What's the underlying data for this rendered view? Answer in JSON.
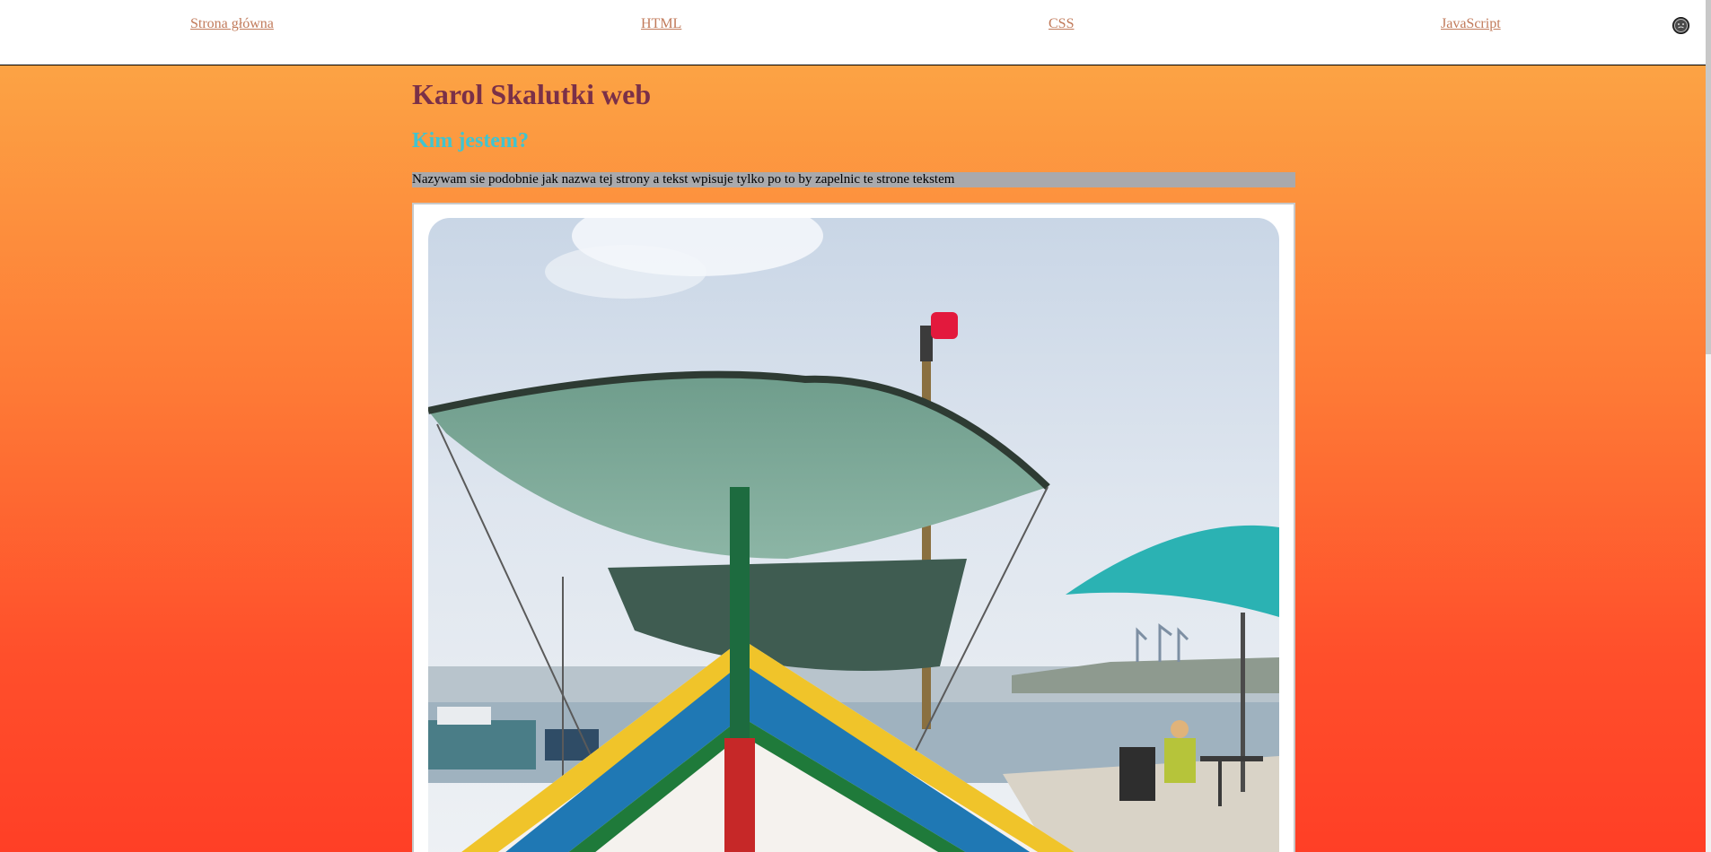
{
  "nav": {
    "home": "Strona główna",
    "html": "HTML",
    "css": "CSS",
    "javascript": "JavaScript",
    "theme_icon": "dark-mode-icon"
  },
  "header": {
    "title": "Karol Skalutki web"
  },
  "about": {
    "heading": "Kim jestem?",
    "text": "Nazywam sie podobnie jak nazwa tej strony a tekst wpisuje tylko po to by zapelnic te strone tekstem"
  },
  "photo": {
    "alt": "boat-photo"
  },
  "colors": {
    "nav_link": "#c17a5a",
    "title": "#7a3048",
    "heading": "#40c4d0",
    "intro_bg": "#a9a9ac",
    "gradient_top": "#fca344",
    "gradient_bottom": "#ff3f26"
  }
}
